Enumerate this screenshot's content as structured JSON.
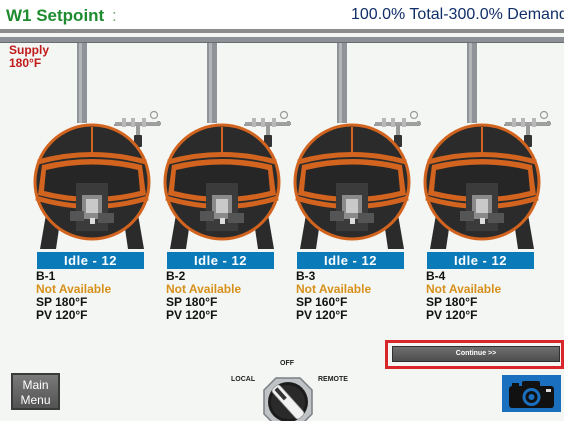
{
  "header": {
    "title": "W1 Setpoint",
    "separator": ":",
    "status": "100.0% Total-300.0% Demand"
  },
  "supply": {
    "label": "Supply",
    "temp": "180°F"
  },
  "boilers": [
    {
      "status": "Idle - 12",
      "name": "B-1",
      "availability": "Not Available",
      "sp": "SP 180°F",
      "pv": "PV 120°F"
    },
    {
      "status": "Idle - 12",
      "name": "B-2",
      "availability": "Not Available",
      "sp": "SP 180°F",
      "pv": "PV 120°F"
    },
    {
      "status": "Idle - 12",
      "name": "B-3",
      "availability": "Not Available",
      "sp": "SP 160°F",
      "pv": "PV 120°F"
    },
    {
      "status": "Idle - 12",
      "name": "B-4",
      "availability": "Not Available",
      "sp": "SP 180°F",
      "pv": "PV 120°F"
    }
  ],
  "controls": {
    "continue_label": "Continue >>",
    "main_menu_line1": "Main",
    "main_menu_line2": "Menu",
    "switch_off": "OFF",
    "switch_local": "LOCAL",
    "switch_remote": "REMOTE",
    "camera_icon": "camera-icon"
  },
  "colors": {
    "title_green": "#1e8c2e",
    "status_blue": "#0a7ab9",
    "not_available": "#d7901b",
    "supply_red": "#c01a1a",
    "boiler_orange": "#d2641f",
    "highlight_red": "#d9262b"
  }
}
